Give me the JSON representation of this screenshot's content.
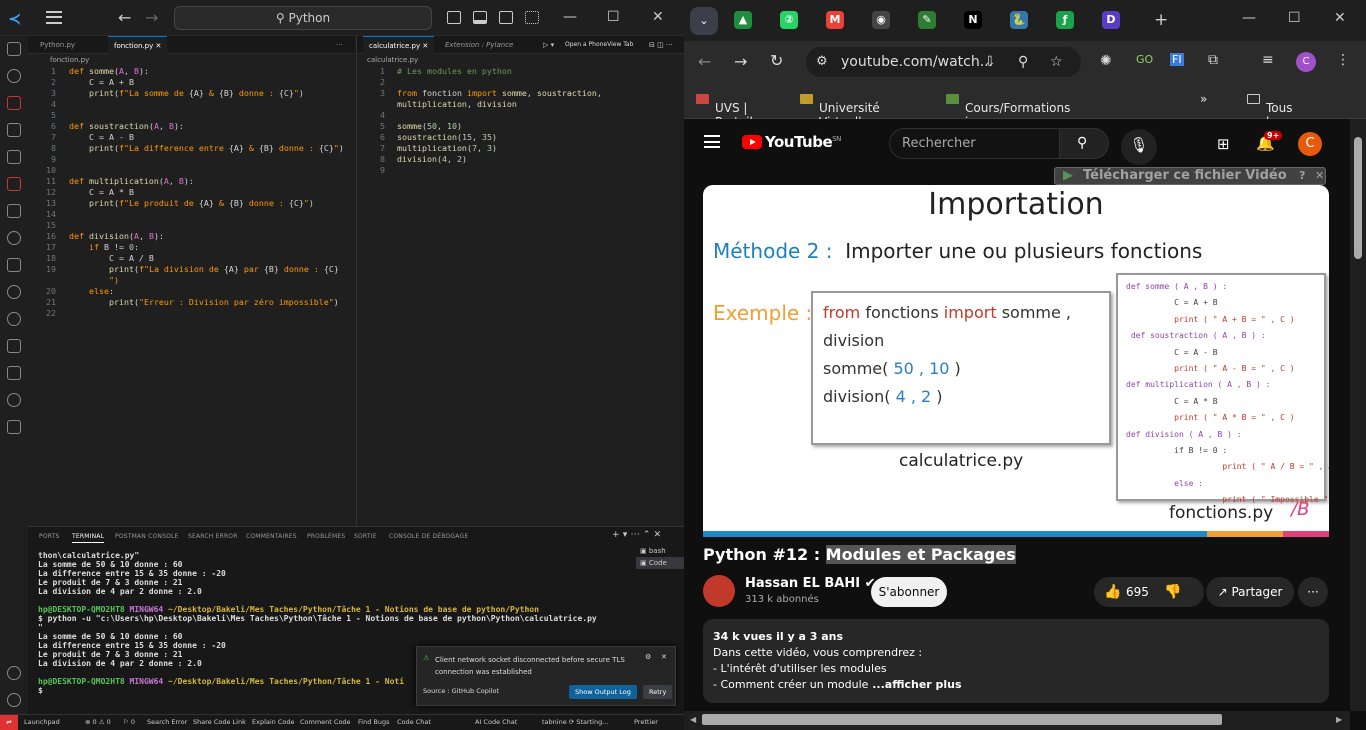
{
  "vscode": {
    "search": "Python",
    "left_editor": {
      "tabs": [
        "Python.py",
        "fonction.py"
      ],
      "breadcrumb": "fonction.py",
      "lines": [
        [
          "1",
          [
            [
              "kw",
              "def "
            ],
            [
              "fn",
              "somme"
            ],
            [
              "op",
              "("
            ],
            [
              "pm",
              "A"
            ],
            [
              "op",
              ", "
            ],
            [
              "pm",
              "B"
            ],
            [
              "op",
              "):"
            ]
          ]
        ],
        [
          "2",
          [
            [
              "op",
              "    C = A + B"
            ]
          ]
        ],
        [
          "3",
          [
            [
              "op",
              "    "
            ],
            [
              "fn",
              "print"
            ],
            [
              "op",
              "("
            ],
            [
              "str",
              "f\"La somme de "
            ],
            [
              "op",
              "{A}"
            ],
            [
              "str",
              " & "
            ],
            [
              "op",
              "{B}"
            ],
            [
              "str",
              " donne : "
            ],
            [
              "op",
              "{C}"
            ],
            [
              "str",
              "\""
            ],
            [
              "op",
              ")"
            ]
          ]
        ],
        [
          "4",
          []
        ],
        [
          "5",
          []
        ],
        [
          "6",
          [
            [
              "kw",
              "def "
            ],
            [
              "fn",
              "soustraction"
            ],
            [
              "op",
              "("
            ],
            [
              "pm",
              "A"
            ],
            [
              "op",
              ", "
            ],
            [
              "pm",
              "B"
            ],
            [
              "op",
              "):"
            ]
          ]
        ],
        [
          "7",
          [
            [
              "op",
              "    C = A - B"
            ]
          ]
        ],
        [
          "8",
          [
            [
              "op",
              "    "
            ],
            [
              "fn",
              "print"
            ],
            [
              "op",
              "("
            ],
            [
              "str",
              "f\"La difference entre "
            ],
            [
              "op",
              "{A}"
            ],
            [
              "str",
              " & "
            ],
            [
              "op",
              "{B}"
            ],
            [
              "str",
              " donne : "
            ],
            [
              "op",
              "{C}"
            ],
            [
              "str",
              "\""
            ],
            [
              "op",
              ")"
            ]
          ]
        ],
        [
          "9",
          []
        ],
        [
          "10",
          []
        ],
        [
          "11",
          [
            [
              "kw",
              "def "
            ],
            [
              "fn",
              "multiplication"
            ],
            [
              "op",
              "("
            ],
            [
              "pm",
              "A"
            ],
            [
              "op",
              ", "
            ],
            [
              "pm",
              "B"
            ],
            [
              "op",
              "):"
            ]
          ]
        ],
        [
          "12",
          [
            [
              "op",
              "    C = A * B"
            ]
          ]
        ],
        [
          "13",
          [
            [
              "op",
              "    "
            ],
            [
              "fn",
              "print"
            ],
            [
              "op",
              "("
            ],
            [
              "str",
              "f\"Le produit de "
            ],
            [
              "op",
              "{A}"
            ],
            [
              "str",
              " & "
            ],
            [
              "op",
              "{B}"
            ],
            [
              "str",
              " donne : "
            ],
            [
              "op",
              "{C}"
            ],
            [
              "str",
              "\""
            ],
            [
              "op",
              ")"
            ]
          ]
        ],
        [
          "14",
          []
        ],
        [
          "15",
          []
        ],
        [
          "16",
          [
            [
              "kw",
              "def "
            ],
            [
              "fn",
              "division"
            ],
            [
              "op",
              "("
            ],
            [
              "pm",
              "A"
            ],
            [
              "op",
              ", "
            ],
            [
              "pm",
              "B"
            ],
            [
              "op",
              "):"
            ]
          ]
        ],
        [
          "17",
          [
            [
              "op",
              "    "
            ],
            [
              "kw",
              "if"
            ],
            [
              "op",
              " B != "
            ],
            [
              "num",
              "0"
            ],
            [
              "op",
              ":"
            ]
          ]
        ],
        [
          "18",
          [
            [
              "op",
              "        C = A / B"
            ]
          ]
        ],
        [
          "19",
          [
            [
              "op",
              "        "
            ],
            [
              "fn",
              "print"
            ],
            [
              "op",
              "("
            ],
            [
              "str",
              "f\"La division de "
            ],
            [
              "op",
              "{A}"
            ],
            [
              "str",
              " par "
            ],
            [
              "op",
              "{B}"
            ],
            [
              "str",
              " donne : "
            ],
            [
              "op",
              "{C}"
            ]
          ]
        ],
        [
          "",
          [
            [
              "str",
              "        \")"
            ]
          ]
        ],
        [
          "20",
          [
            [
              "op",
              "    "
            ],
            [
              "kw",
              "else"
            ],
            [
              "op",
              ":"
            ]
          ]
        ],
        [
          "21",
          [
            [
              "op",
              "        "
            ],
            [
              "fn",
              "print"
            ],
            [
              "op",
              "("
            ],
            [
              "str",
              "\"Erreur : Division par zéro impossible\""
            ],
            [
              "op",
              ")"
            ]
          ]
        ],
        [
          "22",
          []
        ]
      ]
    },
    "right_editor": {
      "tabs": [
        "calculatrice.py",
        "Extension : Pylance"
      ],
      "phone_view": "Open a PhoneView Tab",
      "breadcrumb": "calculatrice.py",
      "lines": [
        [
          "1",
          [
            [
              "cm",
              "# Les modules en python"
            ]
          ]
        ],
        [
          "2",
          []
        ],
        [
          "3",
          [
            [
              "kw",
              "from "
            ],
            [
              "op",
              "fonction "
            ],
            [
              "kw",
              "import "
            ],
            [
              "fn",
              "somme"
            ],
            [
              "op",
              ", "
            ],
            [
              "fn",
              "soustraction"
            ],
            [
              "op",
              ","
            ]
          ]
        ],
        [
          "",
          [
            [
              "fn",
              "multiplication"
            ],
            [
              "op",
              ", "
            ],
            [
              "fn",
              "division"
            ]
          ]
        ],
        [
          "4",
          []
        ],
        [
          "5",
          [
            [
              "fn",
              "somme"
            ],
            [
              "op",
              "("
            ],
            [
              "num",
              "50"
            ],
            [
              "op",
              ", "
            ],
            [
              "num",
              "10"
            ],
            [
              "op",
              ")"
            ]
          ]
        ],
        [
          "6",
          [
            [
              "fn",
              "soustraction"
            ],
            [
              "op",
              "("
            ],
            [
              "num",
              "15"
            ],
            [
              "op",
              ", "
            ],
            [
              "num",
              "35"
            ],
            [
              "op",
              ")"
            ]
          ]
        ],
        [
          "7",
          [
            [
              "fn",
              "multiplication"
            ],
            [
              "op",
              "("
            ],
            [
              "num",
              "7"
            ],
            [
              "op",
              ", "
            ],
            [
              "num",
              "3"
            ],
            [
              "op",
              ")"
            ]
          ]
        ],
        [
          "8",
          [
            [
              "fn",
              "division"
            ],
            [
              "op",
              "("
            ],
            [
              "num",
              "4"
            ],
            [
              "op",
              ", "
            ],
            [
              "num",
              "2"
            ],
            [
              "op",
              ")"
            ]
          ]
        ],
        [
          "9",
          []
        ]
      ]
    },
    "panel": {
      "tabs": [
        "PORTS",
        "TERMINAL",
        "POSTMAN CONSOLE",
        "SEARCH ERROR",
        "COMMENTAIRES",
        "PROBLÈMES",
        "SORTIE",
        "CONSOLE DE DÉBOGAGE"
      ],
      "terminals": [
        "bash",
        "Code"
      ],
      "lines": [
        [
          [
            "",
            "thon\\calculatrice.py\""
          ]
        ],
        [
          [
            "",
            "La somme de 50 & 10 donne : 60"
          ]
        ],
        [
          [
            "",
            "La difference entre 15 & 35 donne : -20"
          ]
        ],
        [
          [
            "",
            "Le produit de 7 & 3 donne : 21"
          ]
        ],
        [
          [
            "",
            "La division de 4 par 2 donne : 2.0"
          ]
        ],
        [
          [
            "",
            ""
          ]
        ],
        [
          [
            "tg",
            "hp@DESKTOP-QMO2HT8 "
          ],
          [
            "tp",
            "MINGW64 "
          ],
          [
            "ty",
            "~/Desktop/Bakeli/Mes Taches/Python/Tâche 1 - Notions de base de python/Python"
          ]
        ],
        [
          [
            "",
            "$ python -u \"c:\\Users\\hp\\Desktop\\Bakeli\\Mes Taches\\Python\\Tâche 1 - Notions de base de python\\Python\\calculatrice.py"
          ]
        ],
        [
          [
            "",
            "\""
          ]
        ],
        [
          [
            "",
            "La somme de 50 & 10 donne : 60"
          ]
        ],
        [
          [
            "",
            "La difference entre 15 & 35 donne : -20"
          ]
        ],
        [
          [
            "",
            "Le produit de 7 & 3 donne : 21"
          ]
        ],
        [
          [
            "",
            "La division de 4 par 2 donne : 2.0"
          ]
        ],
        [
          [
            "",
            ""
          ]
        ],
        [
          [
            "tg",
            "hp@DESKTOP-QMO2HT8 "
          ],
          [
            "tp",
            "MINGW64 "
          ],
          [
            "ty",
            "~/Desktop/Bakeli/Mes Taches/Python/Tâche 1 - Noti"
          ]
        ],
        [
          [
            "",
            "$ "
          ]
        ]
      ],
      "notification": {
        "message": "Client network socket disconnected before secure TLS connection was established",
        "source": "Source : GitHub Copilot",
        "btn_log": "Show Output Log",
        "btn_retry": "Retry"
      }
    },
    "status": [
      "Launchpad",
      "⊗ 0 ⚠ 0",
      "⚐ 0",
      "Search Error",
      "Share Code Link",
      "Explain Code",
      "Comment Code",
      "Find Bugs",
      "Code Chat",
      "AI Code Chat",
      "tabnine ⟳ Starting...",
      "Prettier"
    ]
  },
  "chrome": {
    "url": "youtube.com/watch...",
    "profile": "C",
    "bookmarks": [
      "UVS | Portail",
      "Université Virtuelle...",
      "Cours/Formations i...",
      "Tous les favoris"
    ],
    "favicons": [
      {
        "glyph": "▲",
        "color": "#1e8e3e"
      },
      {
        "glyph": "②",
        "color": "#25d366"
      },
      {
        "glyph": "M",
        "color": "#ea4335"
      },
      {
        "glyph": "◉",
        "color": "#444444"
      },
      {
        "glyph": "✎",
        "color": "#2e7d32"
      },
      {
        "glyph": "N",
        "color": "#000000"
      },
      {
        "glyph": "🐍",
        "color": "#3776ab"
      },
      {
        "glyph": "ƒ",
        "color": "#1aa34a"
      },
      {
        "glyph": "D",
        "color": "#5b3cc4"
      }
    ]
  },
  "youtube": {
    "logo": "YouTube",
    "country": "SN",
    "search_placeholder": "Rechercher",
    "notif_count": "9+",
    "avatar": "C",
    "download_bar": "Télécharger ce fichier Vidéo",
    "video": {
      "title": "Importation",
      "method_label": "Méthode 2 :",
      "method_text": "Importer une ou plusieurs fonctions",
      "example_label": "Exemple :",
      "box_line1": [
        [
          "b2p",
          "from "
        ],
        [
          "b2k",
          "fonctions "
        ],
        [
          "b2p",
          "import "
        ],
        [
          "b2k",
          "somme , division"
        ]
      ],
      "box_line2": [
        [
          "",
          "somme( "
        ],
        [
          "b2b",
          "50 , 10"
        ],
        [
          "",
          " )"
        ]
      ],
      "box_line3": [
        [
          "",
          "division( "
        ],
        [
          "b2b",
          "4 , 2"
        ],
        [
          "",
          " )"
        ]
      ],
      "caption_left": "calculatrice.py",
      "caption_right": "fonctions.py",
      "code_lines": [
        "def somme ( A , B ) :",
        "          C = A + B",
        "          print ( \" A + B = \" , C )",
        " def soustraction ( A , B ) :",
        "          C = A - B",
        "          print ( \" A - B = \" , C )",
        "def multiplication ( A , B ) :",
        "          C = A * B",
        "          print ( \" A * B = \" , C )",
        "def division ( A , B ) :",
        "          if B != 0 :",
        "                    print ( \" A / B = \" , A / B )",
        "          else :",
        "                    print ( \" Impossible \" )"
      ]
    },
    "title_prefix": "Python #12 : ",
    "title_highlight": "Modules et Packages",
    "channel": "Hassan EL BAHI ✔",
    "subscribers": "313 k abonnés",
    "subscribe": "S'abonner",
    "likes": "695",
    "share": "Partager",
    "description": {
      "stats": "34 k vues  il y a 3 ans",
      "lines": [
        "Dans cette vidéo, vous comprendrez :",
        "- L'intérêt d'utiliser les modules"
      ],
      "last": "- Comment créer un module",
      "more": " ...afficher plus"
    }
  }
}
